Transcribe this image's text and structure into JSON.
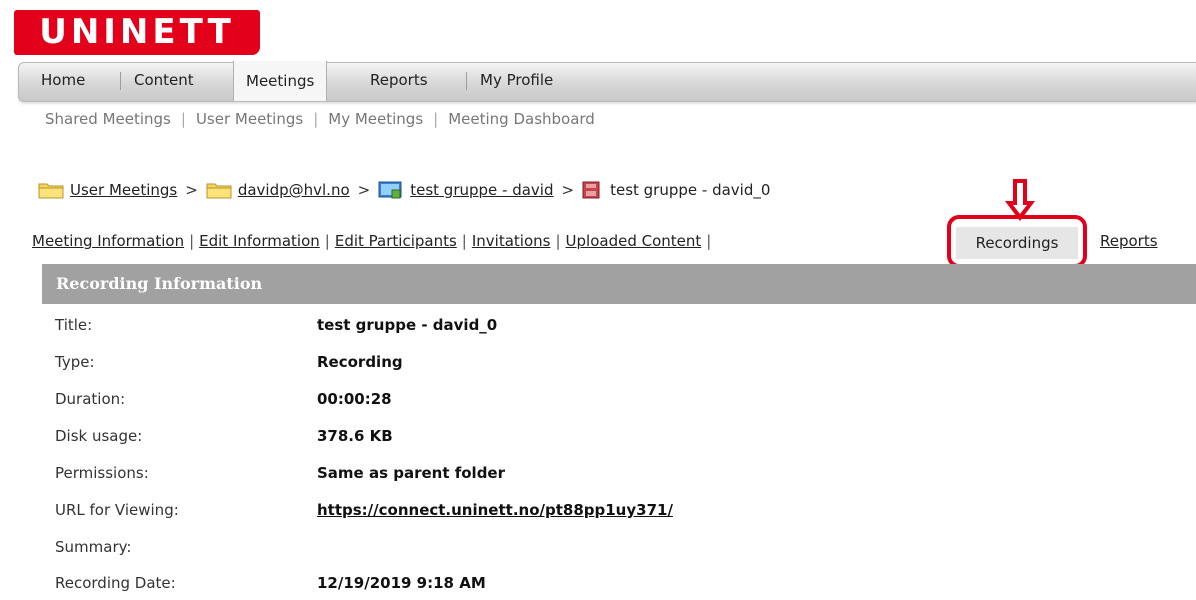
{
  "logo": {
    "text": "UNINETT"
  },
  "nav": {
    "tabs": [
      "Home",
      "Content",
      "Meetings",
      "Reports",
      "My Profile"
    ],
    "active": "Meetings"
  },
  "subnav": {
    "items": [
      "Shared Meetings",
      "User Meetings",
      "My Meetings",
      "Meeting Dashboard"
    ]
  },
  "breadcrumb": {
    "folder1": "User Meetings",
    "folder2": "davidp@hvl.no",
    "meeting": "test gruppe - david",
    "current": "test gruppe - david_0",
    "separator": ">"
  },
  "links": {
    "meeting_information": "Meeting Information",
    "edit_information": "Edit Information",
    "edit_participants": "Edit Participants",
    "invitations": "Invitations",
    "uploaded_content": "Uploaded Content",
    "recordings": "Recordings",
    "reports": "Reports"
  },
  "panel": {
    "header": "Recording Information",
    "fields": {
      "title_label": "Title:",
      "title_value": "test gruppe - david_0",
      "type_label": "Type:",
      "type_value": "Recording",
      "duration_label": "Duration:",
      "duration_value": "00:00:28",
      "disk_label": "Disk usage:",
      "disk_value": "378.6 KB",
      "permissions_label": "Permissions:",
      "permissions_value": "Same as parent folder",
      "url_label": "URL for Viewing:",
      "url_value": "https://connect.uninett.no/pt88pp1uy371/",
      "summary_label": "Summary:",
      "summary_value": "",
      "date_label": "Recording Date:",
      "date_value": "12/19/2019 9:18 AM"
    }
  },
  "colors": {
    "brand": "#e3001b",
    "panel_header": "#a1a1a1",
    "highlight": "#e3001b"
  }
}
